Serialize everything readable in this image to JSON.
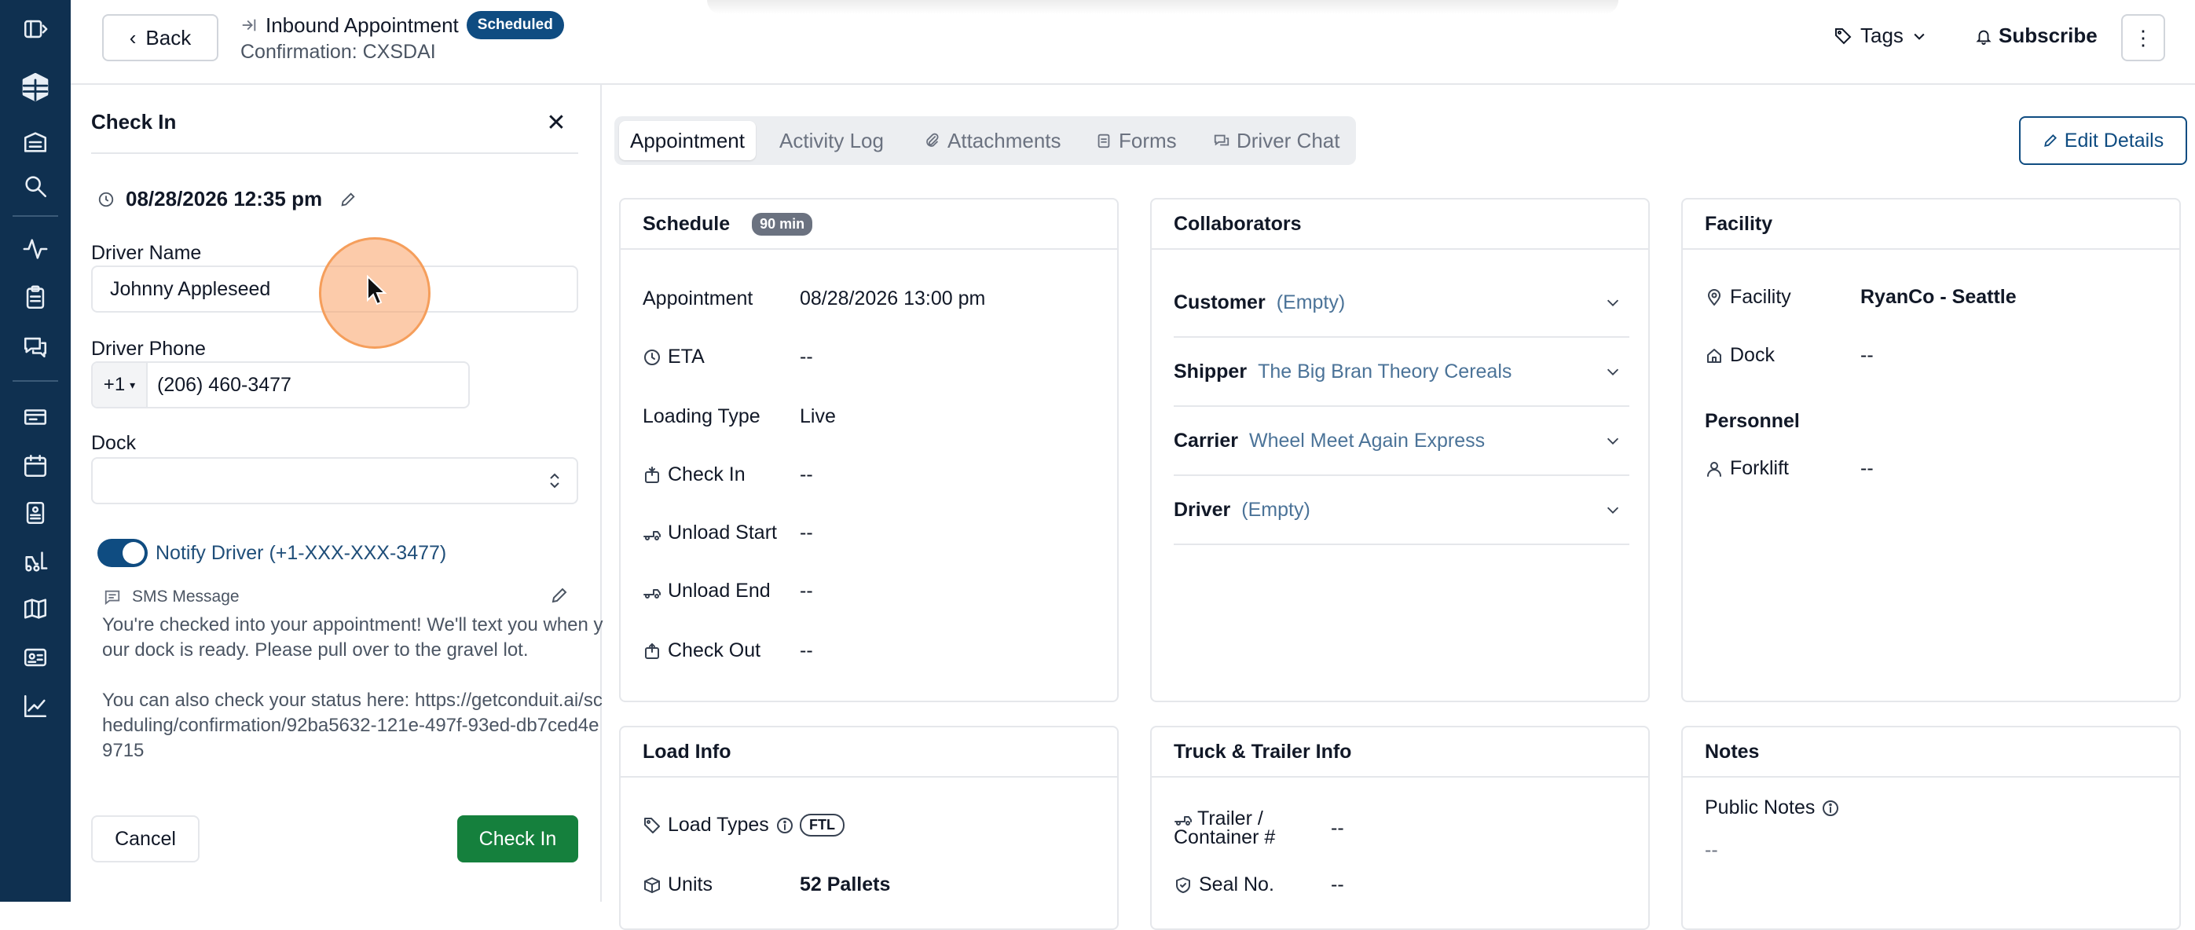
{
  "header": {
    "back_label": "Back",
    "title": "Inbound Appointment",
    "status_badge": "Scheduled",
    "confirmation": "Confirmation: CXSDAI",
    "tags_label": "Tags",
    "subscribe_label": "Subscribe",
    "more_label": "⋮"
  },
  "rail": {
    "icons": [
      "sidebar-toggle-icon",
      "logo-icon",
      "warehouse-icon",
      "search-icon",
      "activity-icon",
      "clipboard-icon",
      "chat-icon",
      "ticket-icon",
      "calendar-icon",
      "dock-door-icon",
      "forklift-icon",
      "map-icon",
      "id-card-icon",
      "chart-icon"
    ]
  },
  "checkin_panel": {
    "title": "Check In",
    "datetime": "08/28/2026 12:35 pm",
    "driver_name_label": "Driver Name",
    "driver_name_value": "Johnny Appleseed",
    "driver_phone_label": "Driver Phone",
    "phone_country_code": "+1",
    "phone_value": "(206) 460-3477",
    "dock_label": "Dock",
    "dock_value": "",
    "notify_label": "Notify Driver (+1-XXX-XXX-3477)",
    "notify_enabled": true,
    "sms_label": "SMS Message",
    "sms_body": "You're checked into your appointment! We'll text you when your dock is ready. Please pull over to the gravel lot.\n\nYou can also check your status here: https://getconduit.ai/scheduling/confirmation/92ba5632-121e-497f-93ed-db7ced4e9715",
    "cancel_label": "Cancel",
    "submit_label": "Check In"
  },
  "tabs": [
    {
      "label": "Appointment",
      "active": true
    },
    {
      "label": "Activity Log",
      "active": false
    },
    {
      "label": "Attachments",
      "active": false
    },
    {
      "label": "Forms",
      "active": false
    },
    {
      "label": "Driver Chat",
      "active": false
    }
  ],
  "edit_details_label": "Edit Details",
  "schedule": {
    "title": "Schedule",
    "duration_badge": "90 min",
    "rows": [
      {
        "label": "Appointment",
        "value": "08/28/2026 13:00 pm",
        "icon": ""
      },
      {
        "label": "ETA",
        "value": "--",
        "icon": "clock-icon"
      },
      {
        "label": "Loading Type",
        "value": "Live",
        "icon": ""
      },
      {
        "label": "Check In",
        "value": "--",
        "icon": "check-in-icon"
      },
      {
        "label": "Unload Start",
        "value": "--",
        "icon": "truck-icon"
      },
      {
        "label": "Unload End",
        "value": "--",
        "icon": "truck-icon"
      },
      {
        "label": "Check Out",
        "value": "--",
        "icon": "check-out-icon"
      }
    ]
  },
  "collaborators": {
    "title": "Collaborators",
    "rows": [
      {
        "label": "Customer",
        "value": "(Empty)"
      },
      {
        "label": "Shipper",
        "value": "The Big Bran Theory Cereals"
      },
      {
        "label": "Carrier",
        "value": "Wheel Meet Again Express"
      },
      {
        "label": "Driver",
        "value": "(Empty)"
      }
    ]
  },
  "facility": {
    "title": "Facility",
    "facility_label": "Facility",
    "facility_value": "RyanCo - Seattle",
    "dock_label": "Dock",
    "dock_value": "--",
    "personnel_heading": "Personnel",
    "forklift_label": "Forklift",
    "forklift_value": "--"
  },
  "load_info": {
    "title": "Load Info",
    "load_types_label": "Load Types",
    "load_types_value": "FTL",
    "units_label": "Units",
    "units_value": "52 Pallets"
  },
  "truck_trailer": {
    "title": "Truck & Trailer Info",
    "trailer_label_1": "Trailer /",
    "trailer_label_2": "Container #",
    "trailer_value": "--",
    "seal_label": "Seal No.",
    "seal_value": "--"
  },
  "notes": {
    "title": "Notes",
    "public_label": "Public Notes",
    "public_value": "--"
  }
}
